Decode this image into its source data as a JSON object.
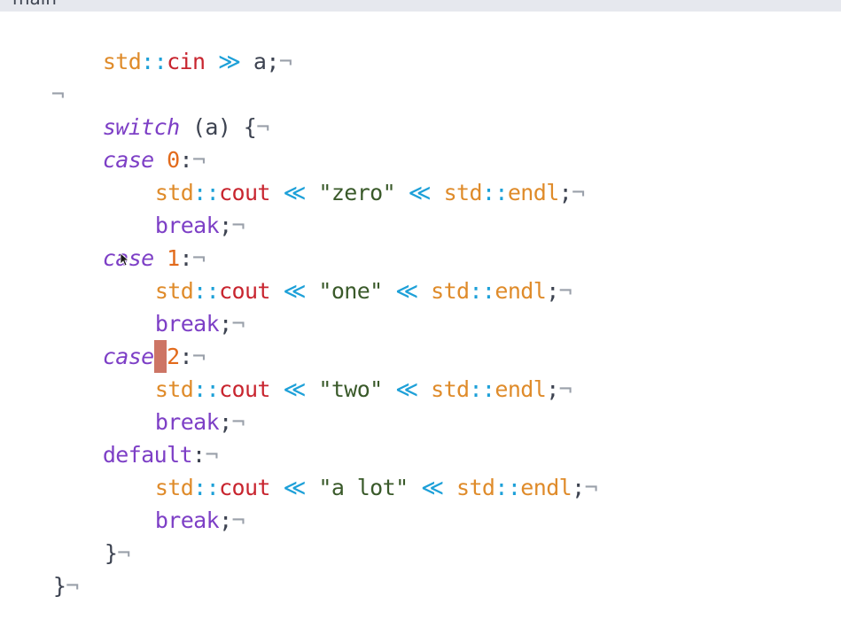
{
  "breadcrumb": {
    "label": "main"
  },
  "colors": {
    "namespace": "#df8b2a",
    "operator": "#1da0d8",
    "identifier": "#c8252f",
    "string": "#3a5a2a",
    "keyword": "#7d3fc6",
    "number": "#e26a1b",
    "plain": "#3d4351",
    "whitespace_marker": "#9aa0aa",
    "caret": "#cd7565"
  },
  "code": {
    "l1": {
      "a": "std",
      "b": "::",
      "c": "cin",
      "d": " ",
      "e": "≫",
      "f": " a;",
      "p": "¬"
    },
    "l2": {
      "p": "¬"
    },
    "l3": {
      "a": "switch",
      "b": " (a) {",
      "p": "¬"
    },
    "l4": {
      "a": "case",
      "b": " ",
      "c": "0",
      "d": ":",
      "p": "¬"
    },
    "l5": {
      "a": "std",
      "b": "::",
      "c": "cout",
      "d": " ",
      "e": "≪",
      "f": " ",
      "g": "\"zero\"",
      "h": " ",
      "i": "≪",
      "j": " ",
      "k": "std",
      "l": "::",
      "m": "endl",
      "n": ";",
      "p": "¬"
    },
    "l6": {
      "a": "break",
      "b": ";",
      "p": "¬"
    },
    "l7": {
      "a": "case",
      "b": " ",
      "c": "1",
      "d": ":",
      "p": "¬"
    },
    "l8": {
      "a": "std",
      "b": "::",
      "c": "cout",
      "d": " ",
      "e": "≪",
      "f": " ",
      "g": "\"one\"",
      "h": " ",
      "i": "≪",
      "j": " ",
      "k": "std",
      "l": "::",
      "m": "endl",
      "n": ";",
      "p": "¬"
    },
    "l9": {
      "a": "break",
      "b": ";",
      "p": "¬"
    },
    "l10": {
      "a": "case",
      "caret": " ",
      "c": "2",
      "d": ":",
      "p": "¬"
    },
    "l11": {
      "a": "std",
      "b": "::",
      "c": "cout",
      "d": " ",
      "e": "≪",
      "f": " ",
      "g": "\"two\"",
      "h": " ",
      "i": "≪",
      "j": " ",
      "k": "std",
      "l": "::",
      "m": "endl",
      "n": ";",
      "p": "¬"
    },
    "l12": {
      "a": "break",
      "b": ";",
      "p": "¬"
    },
    "l13": {
      "a": "default",
      "b": ":",
      "p": "¬"
    },
    "l14": {
      "a": "std",
      "b": "::",
      "c": "cout",
      "d": " ",
      "e": "≪",
      "f": " ",
      "g": "\"a lot\"",
      "h": " ",
      "i": "≪",
      "j": " ",
      "k": "std",
      "l": "::",
      "m": "endl",
      "n": ";",
      "p": "¬"
    },
    "l15": {
      "a": "break",
      "b": ";",
      "p": "¬"
    },
    "l16": {
      "a": "}",
      "p": "¬"
    },
    "l17": {
      "a": "}",
      "p": "¬"
    }
  },
  "mouse_cursor": {
    "icon": "arrow-pointer-icon"
  }
}
